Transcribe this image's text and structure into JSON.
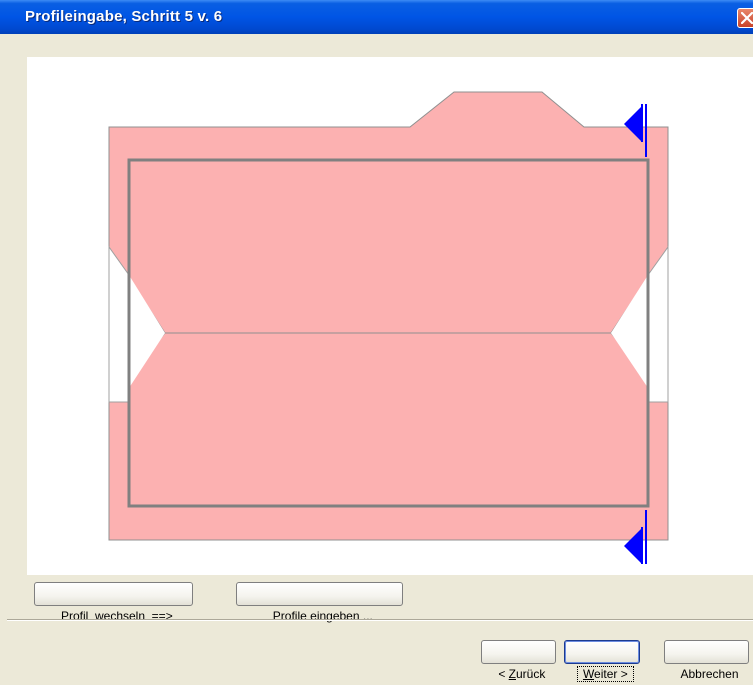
{
  "window": {
    "title": "Profileingabe, Schritt 5 v. 6"
  },
  "icons": {
    "close": "close-icon",
    "cut_marker": "blue-triangle-marker-icon"
  },
  "colors": {
    "profile_fill": "#fcb1b1",
    "profile_outline": "#808080",
    "marker": "#0000ff",
    "title_bar": "#0055e5"
  },
  "buttons": {
    "switch_profile": "Profil  wechseln  ==>",
    "enter_profiles": "Profile eingeben ...",
    "back_prefix": "< ",
    "back_underline": "Z",
    "back_rest": "urück",
    "next_underline": "W",
    "next_rest": "eiter >",
    "cancel": "Abbrechen"
  }
}
